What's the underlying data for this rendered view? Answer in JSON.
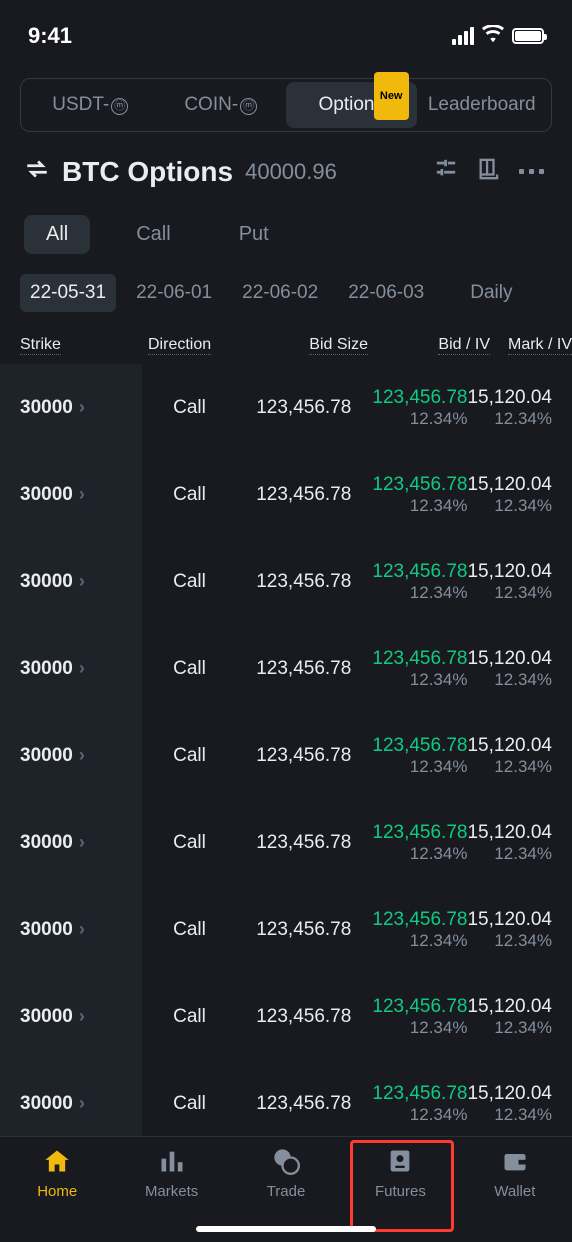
{
  "status": {
    "time": "9:41"
  },
  "topTabs": {
    "items": [
      {
        "label": "USDT-"
      },
      {
        "label": "COIN-"
      },
      {
        "label": "Options",
        "badge": "New"
      },
      {
        "label": "Leaderboard"
      }
    ]
  },
  "header": {
    "pair": "BTC Options",
    "price": "40000.96"
  },
  "filters": {
    "items": [
      "All",
      "Call",
      "Put"
    ]
  },
  "dates": {
    "items": [
      "22-05-31",
      "22-06-01",
      "22-06-02",
      "22-06-03",
      "Daily"
    ]
  },
  "columns": {
    "c1": "Strike",
    "c2": "Direction",
    "c3": "Bid Size",
    "c4": "Bid / IV",
    "c5": "Mark / IV"
  },
  "rows": [
    {
      "strike": "30000",
      "dir": "Call",
      "bidsize": "123,456.78",
      "bid": "123,456.78",
      "biv": "12.34%",
      "mark": "15,120.04",
      "miv": "12.34%"
    },
    {
      "strike": "30000",
      "dir": "Call",
      "bidsize": "123,456.78",
      "bid": "123,456.78",
      "biv": "12.34%",
      "mark": "15,120.04",
      "miv": "12.34%"
    },
    {
      "strike": "30000",
      "dir": "Call",
      "bidsize": "123,456.78",
      "bid": "123,456.78",
      "biv": "12.34%",
      "mark": "15,120.04",
      "miv": "12.34%"
    },
    {
      "strike": "30000",
      "dir": "Call",
      "bidsize": "123,456.78",
      "bid": "123,456.78",
      "biv": "12.34%",
      "mark": "15,120.04",
      "miv": "12.34%"
    },
    {
      "strike": "30000",
      "dir": "Call",
      "bidsize": "123,456.78",
      "bid": "123,456.78",
      "biv": "12.34%",
      "mark": "15,120.04",
      "miv": "12.34%"
    },
    {
      "strike": "30000",
      "dir": "Call",
      "bidsize": "123,456.78",
      "bid": "123,456.78",
      "biv": "12.34%",
      "mark": "15,120.04",
      "miv": "12.34%"
    },
    {
      "strike": "30000",
      "dir": "Call",
      "bidsize": "123,456.78",
      "bid": "123,456.78",
      "biv": "12.34%",
      "mark": "15,120.04",
      "miv": "12.34%"
    },
    {
      "strike": "30000",
      "dir": "Call",
      "bidsize": "123,456.78",
      "bid": "123,456.78",
      "biv": "12.34%",
      "mark": "15,120.04",
      "miv": "12.34%"
    },
    {
      "strike": "30000",
      "dir": "Call",
      "bidsize": "123,456.78",
      "bid": "123,456.78",
      "biv": "12.34%",
      "mark": "15,120.04",
      "miv": "12.34%"
    }
  ],
  "nav": {
    "items": [
      "Home",
      "Markets",
      "Trade",
      "Futures",
      "Wallet"
    ]
  }
}
